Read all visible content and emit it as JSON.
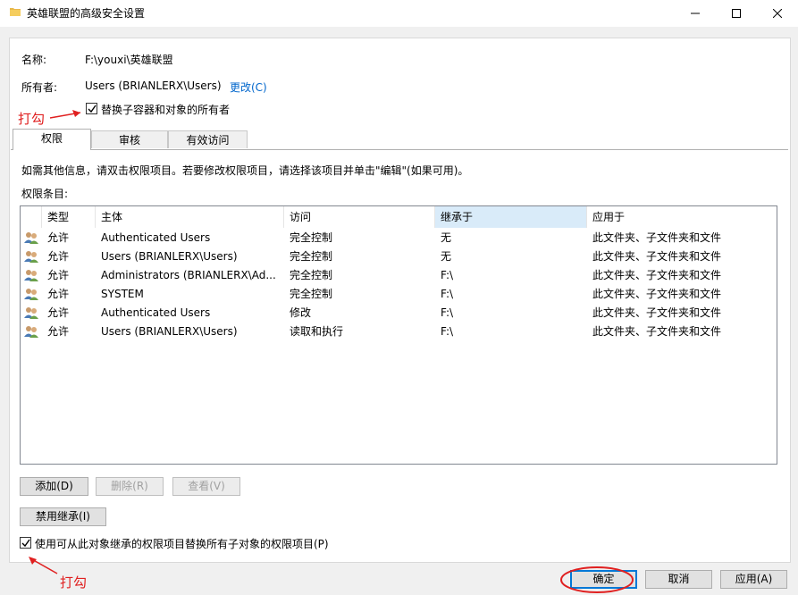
{
  "window": {
    "title": "英雄联盟的高级安全设置"
  },
  "fields": {
    "name_label": "名称:",
    "name_value": "F:\\youxi\\英雄联盟",
    "owner_label": "所有者:",
    "owner_value": "Users (BRIANLERX\\Users)",
    "change_link": "更改(C)",
    "replace_owner_label": "替换子容器和对象的所有者"
  },
  "annotations": {
    "check1": "打勾",
    "check2": "打勾"
  },
  "tabs": [
    {
      "label": "权限",
      "active": true
    },
    {
      "label": "审核",
      "active": false
    },
    {
      "label": "有效访问",
      "active": false
    }
  ],
  "info_text": "如需其他信息，请双击权限项目。若要修改权限项目，请选择该项目并单击\"编辑\"(如果可用)。",
  "entries_label": "权限条目:",
  "table": {
    "headers": [
      "类型",
      "主体",
      "访问",
      "继承于",
      "应用于"
    ],
    "rows": [
      [
        "允许",
        "Authenticated Users",
        "完全控制",
        "无",
        "此文件夹、子文件夹和文件"
      ],
      [
        "允许",
        "Users (BRIANLERX\\Users)",
        "完全控制",
        "无",
        "此文件夹、子文件夹和文件"
      ],
      [
        "允许",
        "Administrators (BRIANLERX\\Ad...",
        "完全控制",
        "F:\\",
        "此文件夹、子文件夹和文件"
      ],
      [
        "允许",
        "SYSTEM",
        "完全控制",
        "F:\\",
        "此文件夹、子文件夹和文件"
      ],
      [
        "允许",
        "Authenticated Users",
        "修改",
        "F:\\",
        "此文件夹、子文件夹和文件"
      ],
      [
        "允许",
        "Users (BRIANLERX\\Users)",
        "读取和执行",
        "F:\\",
        "此文件夹、子文件夹和文件"
      ]
    ]
  },
  "buttons": {
    "add": "添加(D)",
    "remove": "删除(R)",
    "view": "查看(V)",
    "disable_inheritance": "禁用继承(I)",
    "ok": "确定",
    "cancel": "取消",
    "apply": "应用(A)"
  },
  "replace_child_label": "使用可从此对象继承的权限项目替换所有子对象的权限项目(P)",
  "colors": {
    "annotation": "#e02020",
    "link": "#0066cc",
    "accent": "#0078d7"
  }
}
